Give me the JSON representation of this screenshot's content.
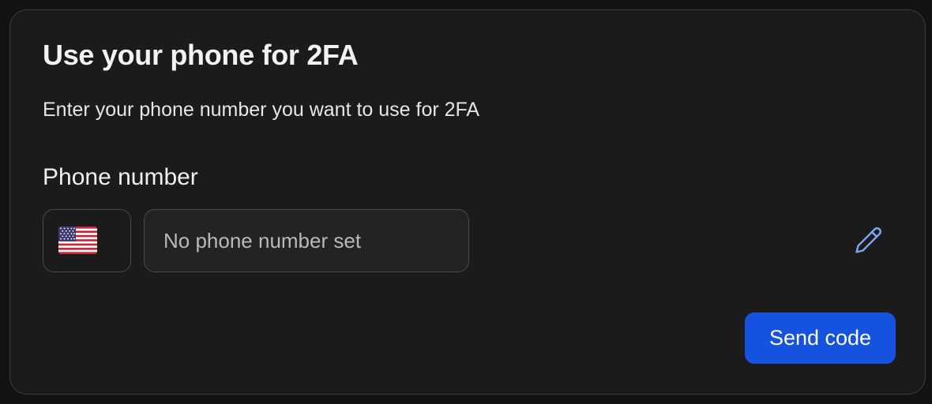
{
  "dialog": {
    "title": "Use your phone for 2FA",
    "description": "Enter your phone number you want to use for 2FA"
  },
  "phone": {
    "label": "Phone number",
    "country_flag": "us-flag-icon",
    "value": "",
    "placeholder": "No phone number set"
  },
  "actions": {
    "edit_icon": "pencil-icon",
    "send_label": "Send code"
  },
  "colors": {
    "card_background": "#1b1b1b",
    "border": "#4a4a4c",
    "accent": "#1652e0",
    "edit_icon": "#7da7f0"
  }
}
